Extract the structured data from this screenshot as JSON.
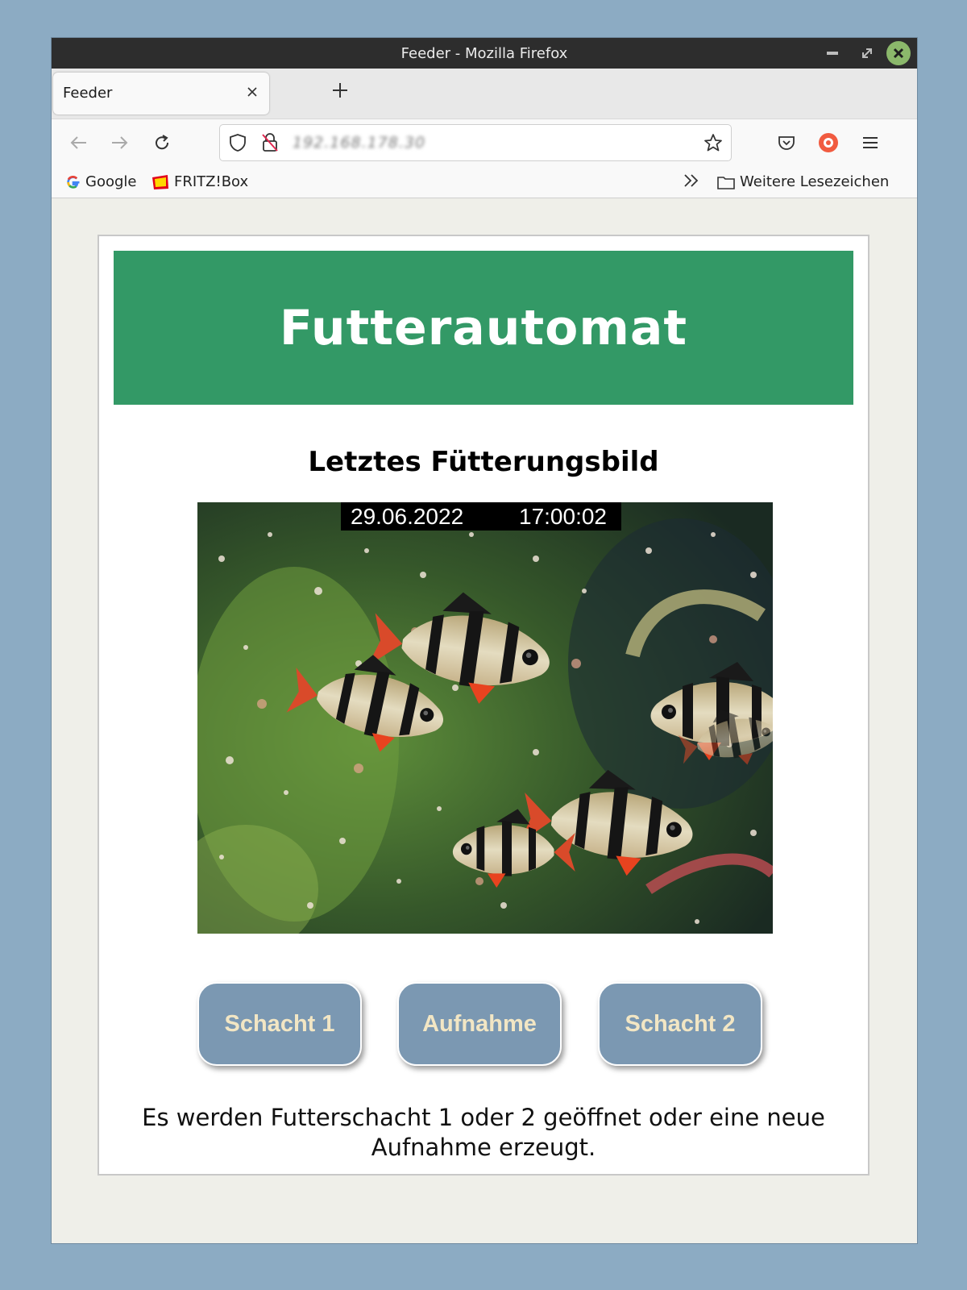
{
  "window": {
    "title": "Feeder - Mozilla Firefox"
  },
  "tabs": [
    {
      "label": "Feeder"
    }
  ],
  "navbar": {
    "url": "192.168.178.30"
  },
  "bookmarks": {
    "items": [
      {
        "label": "Google"
      },
      {
        "label": "FRITZ!Box"
      }
    ],
    "other_label": "Weitere Lesezeichen"
  },
  "page": {
    "header": "Futterautomat",
    "subtitle": "Letztes Fütterungsbild",
    "photo": {
      "date": "29.06.2022",
      "time": "17:00:02"
    },
    "buttons": [
      {
        "label": "Schacht 1"
      },
      {
        "label": "Aufnahme"
      },
      {
        "label": "Schacht 2"
      }
    ],
    "description": "Es werden Futterschacht 1 oder 2 geöffnet oder eine neue Aufnahme erzeugt."
  },
  "colors": {
    "header_bg": "#339966",
    "button_bg": "#7b98b2",
    "button_text": "#f2e6c4",
    "desktop_bg": "#8cabc3"
  }
}
